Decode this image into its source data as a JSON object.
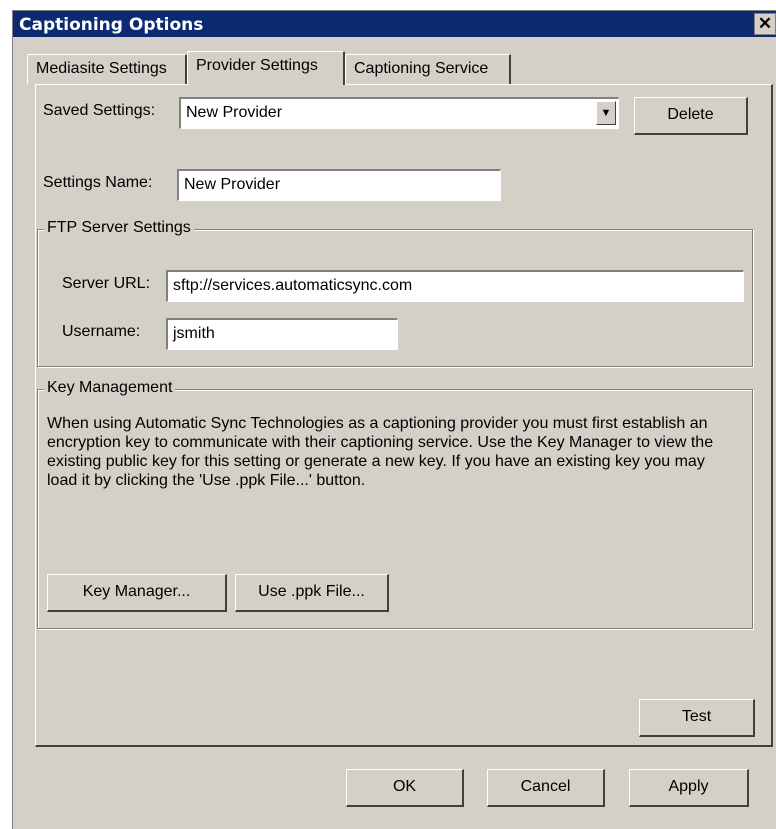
{
  "window": {
    "title": "Captioning Options",
    "close_glyph": "✕"
  },
  "tabs": [
    {
      "label": "Mediasite Settings"
    },
    {
      "label": "Provider Settings",
      "active": true
    },
    {
      "label": "Captioning Service"
    }
  ],
  "saved_settings": {
    "label": "Saved Settings:",
    "value": "New Provider",
    "delete_label": "Delete"
  },
  "settings_name": {
    "label": "Settings Name:",
    "value": "New Provider"
  },
  "ftp": {
    "group_title": "FTP Server Settings",
    "server_url_label": "Server URL:",
    "server_url_value": "sftp://services.automaticsync.com",
    "username_label": "Username:",
    "username_value": "jsmith"
  },
  "key_management": {
    "group_title": "Key Management",
    "description": "When using Automatic Sync Technologies as a captioning provider you must first establish an encryption key to communicate with their captioning service. Use the Key Manager to view the existing public key for this setting or generate a new key. If you have an existing key you may load it by clicking the 'Use .ppk File...' button.",
    "key_manager_label": "Key Manager...",
    "use_ppk_label": "Use .ppk File..."
  },
  "test_label": "Test",
  "footer": {
    "ok_label": "OK",
    "cancel_label": "Cancel",
    "apply_label": "Apply"
  }
}
